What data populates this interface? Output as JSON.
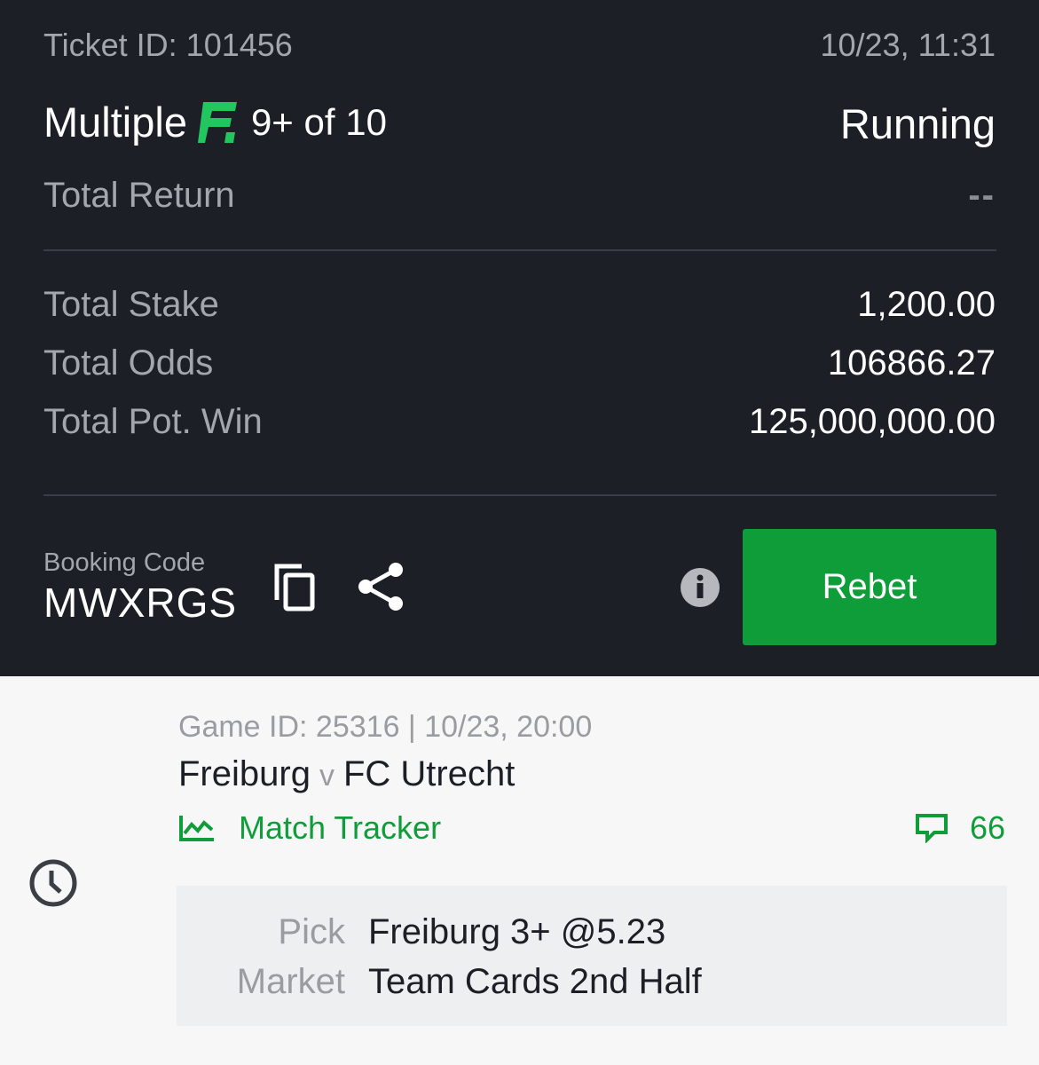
{
  "ticket": {
    "id_text": "Ticket ID: 101456",
    "datetime": "10/23, 11:31",
    "bet_type": "Multiple",
    "flex_label": "9+ of 10",
    "status": "Running",
    "total_return_label": "Total Return",
    "total_return_value": "--",
    "total_stake_label": "Total Stake",
    "total_stake_value": "1,200.00",
    "total_odds_label": "Total Odds",
    "total_odds_value": "106866.27",
    "total_pot_win_label": "Total Pot. Win",
    "total_pot_win_value": "125,000,000.00",
    "booking_code_label": "Booking Code",
    "booking_code": "MWXRGS",
    "rebet_label": "Rebet"
  },
  "game": {
    "meta": "Game ID: 25316 | 10/23, 20:00",
    "home": "Freiburg",
    "vs": "v",
    "away": "FC Utrecht",
    "tracker_label": "Match Tracker",
    "comment_count": "66",
    "pick_label": "Pick",
    "pick_value": "Freiburg 3+ @5.23",
    "market_label": "Market",
    "market_value": "Team Cards 2nd Half"
  },
  "icons": {
    "flex": "flex-badge-icon",
    "copy": "copy-icon",
    "share": "share-icon",
    "info": "info-icon",
    "tracker": "line-chart-icon",
    "comments": "comment-icon",
    "status": "clock-icon"
  },
  "colors": {
    "panel_bg": "#1c1f26",
    "accent_green": "#0f9d3a",
    "flex_green": "#22c55e"
  }
}
